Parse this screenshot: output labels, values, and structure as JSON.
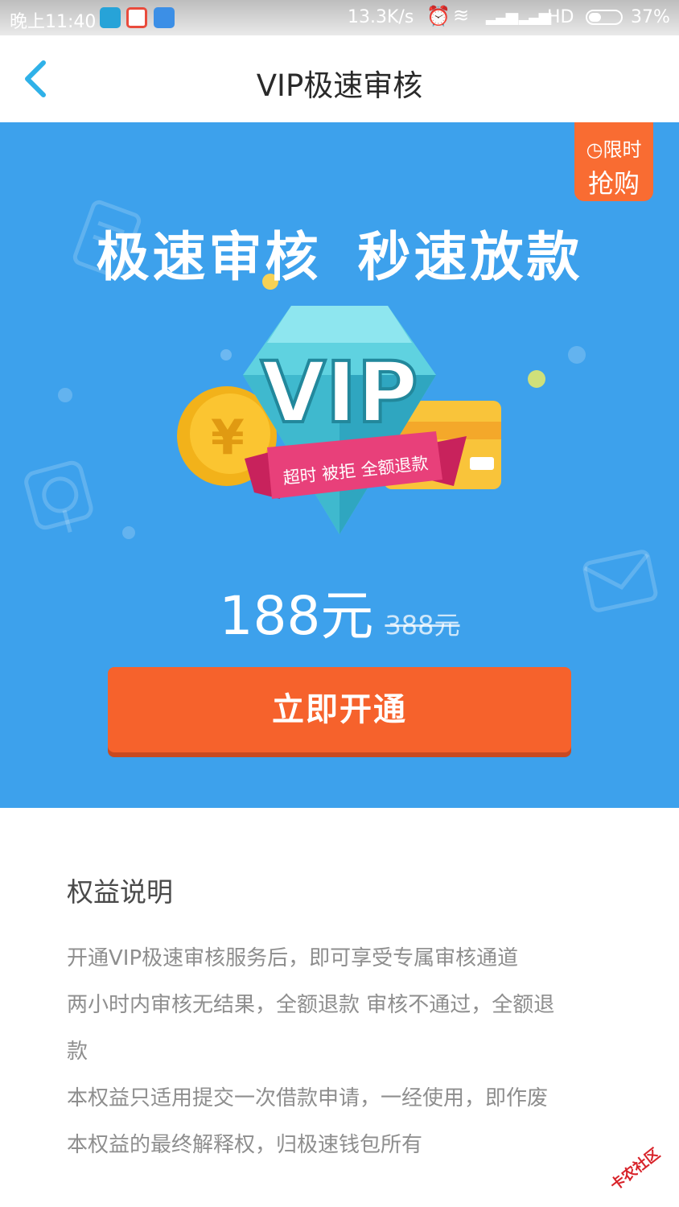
{
  "statusbar": {
    "time": "晚上11:40",
    "net_speed": "13.3K/s",
    "hd": "HD",
    "battery": "37%",
    "icons": [
      "alarm-icon",
      "wifi-icon",
      "signal-icon",
      "signal-icon",
      "battery-icon"
    ]
  },
  "nav": {
    "title": "VIP极速审核",
    "back_icon": "chevron-left-icon"
  },
  "banner": {
    "tag_line1": "限时",
    "tag_line2": "抢购",
    "headline": "极速审核 秒速放款",
    "vip_text": "VIP",
    "ribbon_text": "超时 被拒 全额退款",
    "price": "188元",
    "original_price": "388元",
    "cta_label": "立即开通"
  },
  "rights": {
    "heading": "权益说明",
    "lines": [
      "开通VIP极速审核服务后，即可享受专属审核通道",
      "两小时内审核无结果，全额退款 审核不通过，全额退",
      "款",
      "本权益只适用提交一次借款申请，一经使用，即作废",
      "本权益的最终解释权，归极速钱包所有"
    ]
  },
  "watermark": "卡农社区",
  "colors": {
    "banner": "#3da1ec",
    "cta": "#f6622c",
    "tag": "#f96c32",
    "accent": "#2fb1e8"
  }
}
